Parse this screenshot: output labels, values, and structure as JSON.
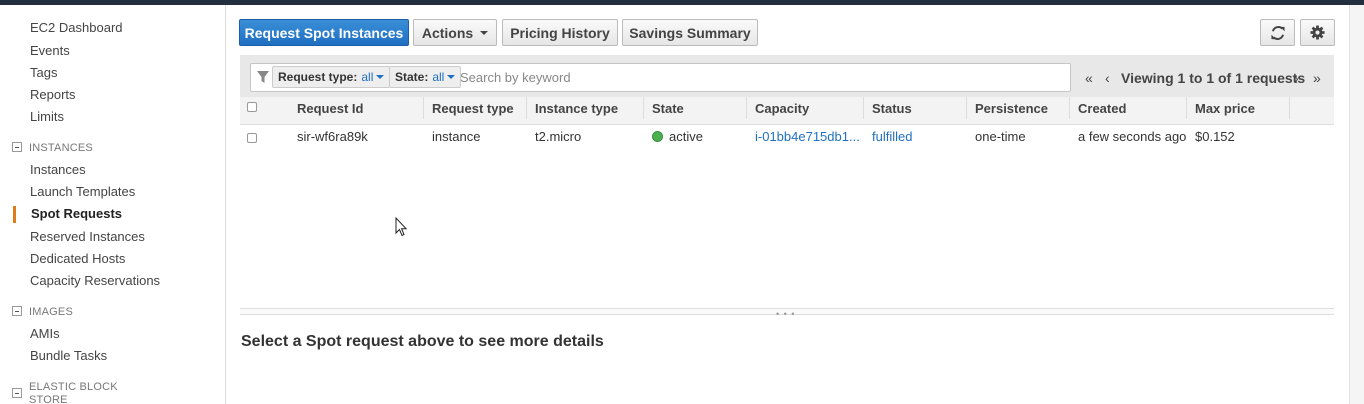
{
  "sidebar": {
    "top_items": [
      "EC2 Dashboard",
      "Events",
      "Tags",
      "Reports",
      "Limits"
    ],
    "sections": [
      {
        "title": "INSTANCES",
        "items": [
          "Instances",
          "Launch Templates",
          "Spot Requests",
          "Reserved Instances",
          "Dedicated Hosts",
          "Capacity Reservations"
        ]
      },
      {
        "title": "IMAGES",
        "items": [
          "AMIs",
          "Bundle Tasks"
        ]
      },
      {
        "title": "ELASTIC BLOCK STORE",
        "items": []
      }
    ],
    "active_item": "Spot Requests"
  },
  "toolbar": {
    "request_label": "Request Spot Instances",
    "actions_label": "Actions",
    "pricing_history_label": "Pricing History",
    "savings_summary_label": "Savings Summary",
    "refresh_icon": "refresh-icon",
    "settings_icon": "gear-icon"
  },
  "filter": {
    "tokens": [
      {
        "label": "Request type:",
        "value": "all"
      },
      {
        "label": "State:",
        "value": "all"
      }
    ],
    "search_placeholder": "Search by keyword",
    "pager_text": "Viewing 1 to 1 of 1 requests"
  },
  "table": {
    "columns": [
      "Request Id",
      "Request type",
      "Instance type",
      "State",
      "Capacity",
      "Status",
      "Persistence",
      "Created",
      "Max price"
    ],
    "rows": [
      {
        "request_id": "sir-wf6ra89k",
        "request_type": "instance",
        "instance_type": "t2.micro",
        "state": "active",
        "capacity": "i-01bb4e715db1...",
        "status": "fulfilled",
        "persistence": "one-time",
        "created": "a few seconds ago",
        "max_price": "$0.152"
      }
    ]
  },
  "details": {
    "message": "Select a Spot request above to see more details"
  },
  "colors": {
    "primary": "#1f6fc2",
    "active_marker": "#e07b1c",
    "state_active": "#4caf50",
    "topbar": "#232f3e"
  }
}
